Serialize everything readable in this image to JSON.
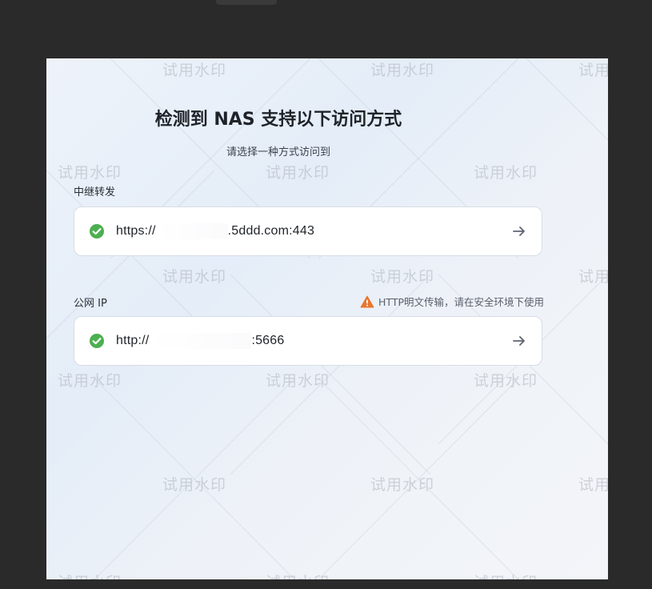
{
  "title": "检测到 NAS 支持以下访问方式",
  "subtitle": "请选择一种方式访问到",
  "sections": [
    {
      "label": "中继转发",
      "url_prefix": "https://",
      "url_suffix": ".5ddd.com:443",
      "status_icon": "check-circle-icon",
      "action_icon": "arrow-right-icon"
    },
    {
      "label": "公网 IP",
      "url_prefix": "http://",
      "url_suffix": ":5666",
      "status_icon": "check-circle-icon",
      "action_icon": "arrow-right-icon",
      "warning": "HTTP明文传输，请在安全环境下使用",
      "warning_icon": "warning-triangle-icon"
    }
  ],
  "watermark_text": "试用水印",
  "colors": {
    "success": "#4caf50",
    "warning": "#e8772e",
    "arrow": "#5f6672"
  }
}
